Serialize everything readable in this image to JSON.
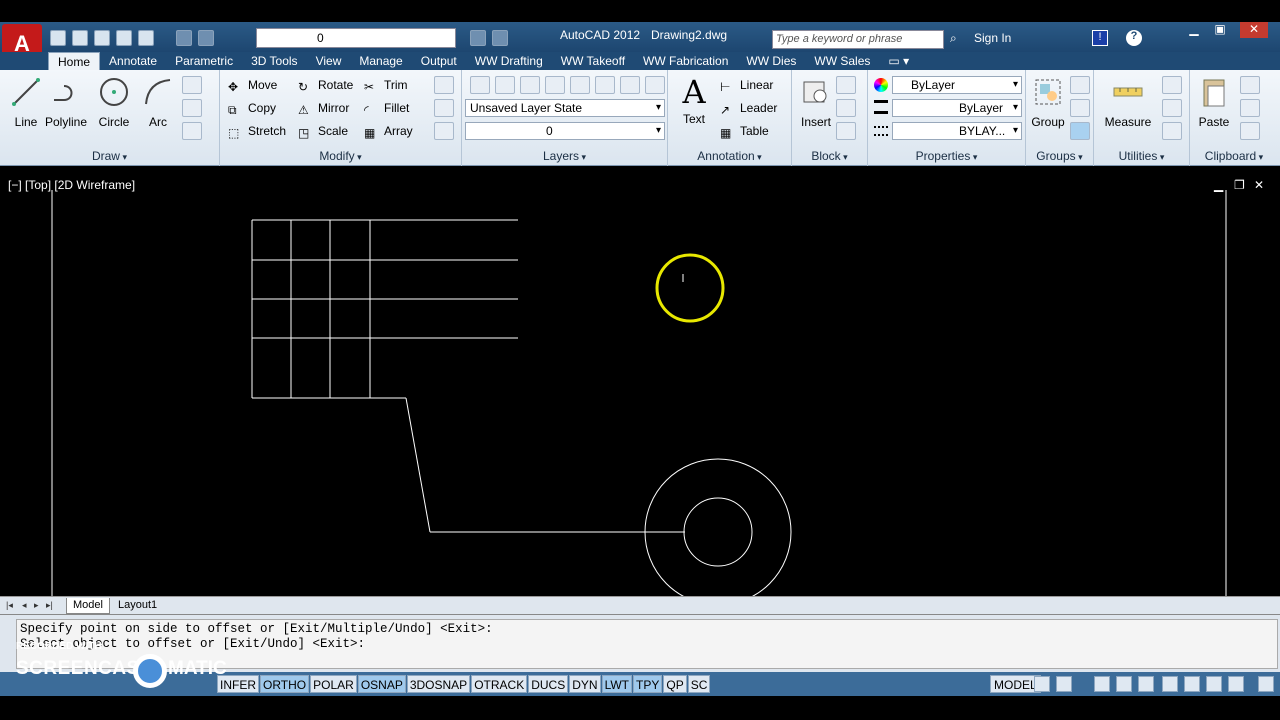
{
  "titlebar": {
    "app_title": "AutoCAD 2012",
    "doc_title": "Drawing2.dwg",
    "search_placeholder": "Type a keyword or phrase",
    "sign_in": "Sign In",
    "workspace_layer": "0"
  },
  "tabs": [
    "Home",
    "Annotate",
    "Parametric",
    "3D Tools",
    "View",
    "Manage",
    "Output",
    "WW Drafting",
    "WW Takeoff",
    "WW Fabrication",
    "WW Dies",
    "WW Sales"
  ],
  "ribbon": {
    "draw": {
      "title": "Draw",
      "line": "Line",
      "polyline": "Polyline",
      "circle": "Circle",
      "arc": "Arc"
    },
    "modify": {
      "title": "Modify",
      "move": "Move",
      "rotate": "Rotate",
      "trim": "Trim",
      "copy": "Copy",
      "mirror": "Mirror",
      "fillet": "Fillet",
      "stretch": "Stretch",
      "scale": "Scale",
      "array": "Array"
    },
    "layers": {
      "title": "Layers",
      "layer_state": "Unsaved Layer State",
      "current_layer": "0"
    },
    "annotation": {
      "title": "Annotation",
      "text": "Text",
      "linear": "Linear",
      "leader": "Leader",
      "table": "Table"
    },
    "block": {
      "title": "Block",
      "insert": "Insert"
    },
    "properties": {
      "title": "Properties",
      "color": "ByLayer",
      "lineweight": "ByLayer",
      "linetype": "BYLAY..."
    },
    "groups": {
      "title": "Groups",
      "group": "Group"
    },
    "utilities": {
      "title": "Utilities",
      "measure": "Measure"
    },
    "clipboard": {
      "title": "Clipboard",
      "paste": "Paste"
    }
  },
  "viewport": {
    "label": "[−] [Top] [2D Wireframe]"
  },
  "layout_tabs": [
    "Model",
    "Layout1"
  ],
  "command": {
    "line1": "Specify point on side to offset or [Exit/Multiple/Undo] <Exit>:",
    "line2": "Select object to offset or [Exit/Undo] <Exit>:"
  },
  "status": {
    "toggles": [
      {
        "label": "INFER",
        "on": false
      },
      {
        "label": "ORTHO",
        "on": true
      },
      {
        "label": "POLAR",
        "on": false
      },
      {
        "label": "OSNAP",
        "on": true
      },
      {
        "label": "3DOSNAP",
        "on": false
      },
      {
        "label": "OTRACK",
        "on": false
      },
      {
        "label": "DUCS",
        "on": false
      },
      {
        "label": "DYN",
        "on": false
      },
      {
        "label": "LWT",
        "on": true
      },
      {
        "label": "TPY",
        "on": true
      },
      {
        "label": "QP",
        "on": false
      },
      {
        "label": "SC",
        "on": false
      }
    ],
    "model": "MODEL"
  },
  "watermark": {
    "recorded": "RECORDED WITH",
    "brand_left": "SCREENCAST",
    "brand_right": "MATIC"
  },
  "colors": {
    "accent": "#1f4a74",
    "cursor_highlight": "#e8e800",
    "drawing_bg": "#000000"
  }
}
